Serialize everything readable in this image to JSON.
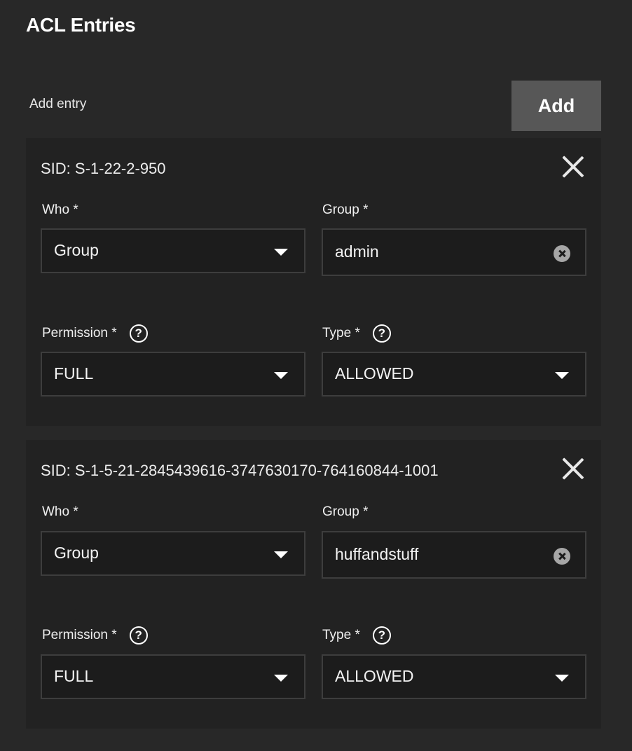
{
  "page": {
    "title": "ACL Entries",
    "add_entry_label": "Add entry",
    "add_button_label": "Add"
  },
  "entries": [
    {
      "sid": "SID: S-1-22-2-950",
      "who_label": "Who *",
      "who_value": "Group",
      "group_label": "Group *",
      "group_value": "admin",
      "permission_label": "Permission *",
      "permission_value": "FULL",
      "type_label": "Type *",
      "type_value": "ALLOWED"
    },
    {
      "sid": "SID: S-1-5-21-2845439616-3747630170-764160844-1001",
      "who_label": "Who *",
      "who_value": "Group",
      "group_label": "Group *",
      "group_value": "huffandstuff",
      "permission_label": "Permission *",
      "permission_value": "FULL",
      "type_label": "Type *",
      "type_value": "ALLOWED"
    }
  ],
  "icons": {
    "close": "close-icon",
    "help": "help-circle-icon",
    "dropdown": "caret-down-icon",
    "clear": "clear-circle-icon",
    "help_glyph": "?"
  },
  "colors": {
    "background": "#282828",
    "card": "#222222",
    "input": "#1c1c1c",
    "button": "#575757"
  }
}
